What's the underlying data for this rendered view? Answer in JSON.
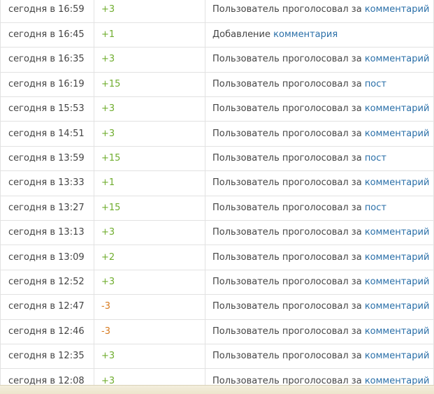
{
  "rows": [
    {
      "time": "сегодня в 16:59",
      "points": "+3",
      "sign": "pos",
      "text": "Пользователь проголосовал за",
      "link": "комментарий"
    },
    {
      "time": "сегодня в 16:45",
      "points": "+1",
      "sign": "pos",
      "text": "Добавление",
      "link": "комментария"
    },
    {
      "time": "сегодня в 16:35",
      "points": "+3",
      "sign": "pos",
      "text": "Пользователь проголосовал за",
      "link": "комментарий"
    },
    {
      "time": "сегодня в 16:19",
      "points": "+15",
      "sign": "pos",
      "text": "Пользователь проголосовал за",
      "link": "пост"
    },
    {
      "time": "сегодня в 15:53",
      "points": "+3",
      "sign": "pos",
      "text": "Пользователь проголосовал за",
      "link": "комментарий"
    },
    {
      "time": "сегодня в 14:51",
      "points": "+3",
      "sign": "pos",
      "text": "Пользователь проголосовал за",
      "link": "комментарий"
    },
    {
      "time": "сегодня в 13:59",
      "points": "+15",
      "sign": "pos",
      "text": "Пользователь проголосовал за",
      "link": "пост"
    },
    {
      "time": "сегодня в 13:33",
      "points": "+1",
      "sign": "pos",
      "text": "Пользователь проголосовал за",
      "link": "комментарий"
    },
    {
      "time": "сегодня в 13:27",
      "points": "+15",
      "sign": "pos",
      "text": "Пользователь проголосовал за",
      "link": "пост"
    },
    {
      "time": "сегодня в 13:13",
      "points": "+3",
      "sign": "pos",
      "text": "Пользователь проголосовал за",
      "link": "комментарий"
    },
    {
      "time": "сегодня в 13:09",
      "points": "+2",
      "sign": "pos",
      "text": "Пользователь проголосовал за",
      "link": "комментарий"
    },
    {
      "time": "сегодня в 12:52",
      "points": "+3",
      "sign": "pos",
      "text": "Пользователь проголосовал за",
      "link": "комментарий"
    },
    {
      "time": "сегодня в 12:47",
      "points": "-3",
      "sign": "neg",
      "text": "Пользователь проголосовал за",
      "link": "комментарий"
    },
    {
      "time": "сегодня в 12:46",
      "points": "-3",
      "sign": "neg",
      "text": "Пользователь проголосовал за",
      "link": "комментарий"
    },
    {
      "time": "сегодня в 12:35",
      "points": "+3",
      "sign": "pos",
      "text": "Пользователь проголосовал за",
      "link": "комментарий"
    },
    {
      "time": "сегодня в 12:08",
      "points": "+3",
      "sign": "pos",
      "text": "Пользователь проголосовал за",
      "link": "комментарий"
    }
  ],
  "colors": {
    "positive": "#6fad2e",
    "negative": "#d77a1f",
    "link": "#2a6fa8",
    "text": "#444444",
    "border": "#e2e2e2"
  }
}
